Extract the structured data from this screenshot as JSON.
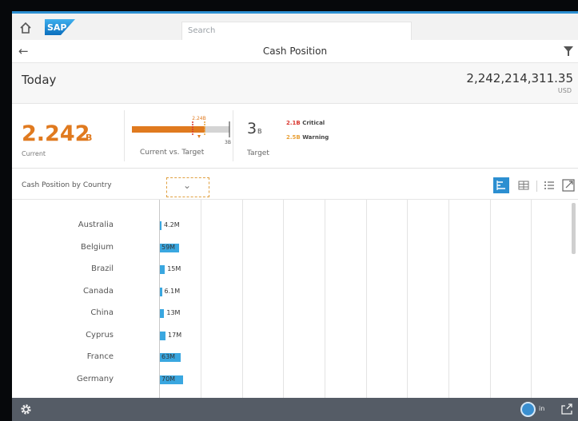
{
  "topbar": {
    "brand": "SAP",
    "search_placeholder": "Search",
    "accent": "#2c8fd1"
  },
  "header": {
    "title": "Cash Position"
  },
  "today": {
    "label": "Today",
    "value": "2,242,214,311.35",
    "currency": "USD"
  },
  "kpi": {
    "current_value": "2.242",
    "current_scale": "B",
    "current_label": "Current",
    "gauge_value_label": "2.24B",
    "gauge_target_label": "3B",
    "gauge_label": "Current vs. Target",
    "gauge_fill_fraction": 0.75,
    "target_value": "3",
    "target_scale": "B",
    "target_label": "Target",
    "critical_value": "2.1B",
    "critical_label": "Critical",
    "warning_value": "2.5B",
    "warning_label": "Warning",
    "color_current": "#e07a1f",
    "color_critical": "#d9362e",
    "color_warning": "#e9a23a"
  },
  "chart_toolbar": {
    "title": "Cash Position by Country",
    "dropdown_chevron": "chevron-down-icon",
    "buttons": [
      "bar-chart-icon",
      "table-icon",
      "list-icon",
      "fullscreen-icon"
    ]
  },
  "chart_data": {
    "type": "bar",
    "orientation": "horizontal",
    "categories": [
      "Australia",
      "Belgium",
      "Brazil",
      "Canada",
      "China",
      "Cyprus",
      "France",
      "Germany"
    ],
    "values": [
      4.2,
      59,
      15,
      6.1,
      13,
      17,
      63,
      70
    ],
    "value_labels": [
      "4.2M",
      "59M",
      "15M",
      "6.1M",
      "13M",
      "17M",
      "63M",
      "70M"
    ],
    "unit": "M",
    "color": "#3aa7e0",
    "grid": true
  },
  "footer": {
    "user_initials": "in"
  }
}
